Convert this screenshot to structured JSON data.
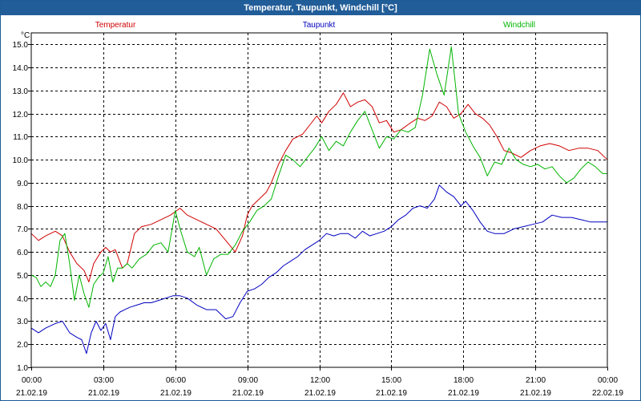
{
  "window_title": "Temperatur, Taupunkt, Windchill [°C]",
  "colors": {
    "temperatur": "#d00000",
    "taupunkt": "#0000c0",
    "windchill": "#00b400",
    "titlebar": "#215d98"
  },
  "chart_data": {
    "type": "line",
    "title": "Temperatur, Taupunkt, Windchill [°C]",
    "ylabel": "°C",
    "ylim": [
      1.0,
      15.5
    ],
    "yticks": [
      "1.0",
      "2.0",
      "3.0",
      "4.0",
      "5.0",
      "6.0",
      "7.0",
      "8.0",
      "9.0",
      "10.0",
      "11.0",
      "12.0",
      "13.0",
      "14.0",
      "15.0"
    ],
    "xlim_hours": [
      0,
      24
    ],
    "xticks": [
      {
        "time": "00:00",
        "date": "21.02.19"
      },
      {
        "time": "03:00",
        "date": "21.02.19"
      },
      {
        "time": "06:00",
        "date": "21.02.19"
      },
      {
        "time": "09:00",
        "date": "21.02.19"
      },
      {
        "time": "12:00",
        "date": "21.02.19"
      },
      {
        "time": "15:00",
        "date": "21.02.19"
      },
      {
        "time": "18:00",
        "date": "21.02.19"
      },
      {
        "time": "21:00",
        "date": "21.02.19"
      },
      {
        "time": "00:00",
        "date": "22.02.19"
      }
    ],
    "grid": true,
    "series": [
      {
        "name": "Temperatur",
        "color": "#d00000",
        "x": [
          0,
          0.3,
          0.6,
          1,
          1.3,
          1.6,
          1.9,
          2.2,
          2.4,
          2.6,
          2.9,
          3.1,
          3.3,
          3.5,
          3.8,
          4,
          4.3,
          4.6,
          5,
          5.4,
          5.8,
          6.2,
          6.5,
          6.9,
          7.3,
          7.7,
          8.1,
          8.5,
          8.8,
          9,
          9.2,
          9.5,
          9.8,
          10,
          10.3,
          10.6,
          10.9,
          11.3,
          11.6,
          11.9,
          12.1,
          12.4,
          12.7,
          13,
          13.3,
          13.6,
          13.9,
          14.2,
          14.5,
          14.8,
          15.1,
          15.4,
          15.8,
          16.1,
          16.4,
          16.7,
          17,
          17.3,
          17.6,
          17.9,
          18.2,
          18.5,
          18.8,
          19.1,
          19.4,
          19.7,
          20,
          20.4,
          20.8,
          21.2,
          21.6,
          22,
          22.4,
          22.8,
          23.2,
          23.6,
          24
        ],
        "y": [
          6.8,
          6.5,
          6.7,
          6.9,
          6.7,
          6.0,
          5.5,
          5.2,
          4.7,
          5.5,
          6.0,
          6.2,
          6.0,
          6.1,
          5.3,
          5.5,
          6.8,
          7.1,
          7.2,
          7.4,
          7.6,
          7.9,
          7.6,
          7.4,
          7.2,
          7.0,
          6.5,
          6.0,
          6.7,
          7.6,
          8.0,
          8.3,
          8.6,
          9.0,
          9.8,
          10.4,
          10.9,
          11.1,
          11.5,
          11.9,
          11.6,
          12.1,
          12.4,
          12.9,
          12.3,
          12.5,
          12.6,
          12.3,
          11.6,
          11.7,
          11.2,
          11.3,
          11.6,
          11.8,
          11.7,
          11.9,
          12.5,
          12.3,
          11.8,
          12.0,
          12.4,
          12.0,
          11.8,
          11.5,
          11.0,
          10.4,
          10.3,
          10.1,
          10.4,
          10.6,
          10.7,
          10.6,
          10.4,
          10.5,
          10.5,
          10.4,
          10.0
        ]
      },
      {
        "name": "Taupunkt",
        "color": "#0000c0",
        "x": [
          0,
          0.3,
          0.6,
          1,
          1.3,
          1.6,
          1.9,
          2.1,
          2.3,
          2.5,
          2.7,
          2.9,
          3.1,
          3.3,
          3.5,
          3.7,
          3.9,
          4.1,
          4.4,
          4.7,
          5,
          5.3,
          5.6,
          5.9,
          6.2,
          6.5,
          6.9,
          7.3,
          7.7,
          8.1,
          8.4,
          8.7,
          9,
          9.3,
          9.6,
          9.9,
          10.2,
          10.5,
          10.8,
          11.1,
          11.4,
          11.7,
          12,
          12.3,
          12.6,
          12.9,
          13.2,
          13.5,
          13.8,
          14.1,
          14.4,
          14.7,
          15,
          15.3,
          15.6,
          15.9,
          16.2,
          16.5,
          16.8,
          17,
          17.3,
          17.6,
          17.9,
          18.1,
          18.4,
          18.7,
          19,
          19.3,
          19.7,
          20.1,
          20.5,
          20.9,
          21.3,
          21.7,
          22.1,
          22.5,
          22.9,
          23.3,
          23.7,
          24
        ],
        "y": [
          2.7,
          2.5,
          2.7,
          2.9,
          3.0,
          2.5,
          2.3,
          2.2,
          1.6,
          2.5,
          3.0,
          2.6,
          2.9,
          2.2,
          3.2,
          3.4,
          3.5,
          3.6,
          3.7,
          3.8,
          3.8,
          3.9,
          4.0,
          4.1,
          4.1,
          4.0,
          3.7,
          3.5,
          3.5,
          3.1,
          3.2,
          3.8,
          4.3,
          4.4,
          4.6,
          4.9,
          5.1,
          5.4,
          5.6,
          5.8,
          6.1,
          6.3,
          6.5,
          6.8,
          6.7,
          6.8,
          6.8,
          6.6,
          6.9,
          6.7,
          6.8,
          6.9,
          7.1,
          7.4,
          7.6,
          7.9,
          8.0,
          7.9,
          8.3,
          8.9,
          8.6,
          8.4,
          8.0,
          8.2,
          7.8,
          7.3,
          6.9,
          6.8,
          6.8,
          7.0,
          7.1,
          7.2,
          7.3,
          7.6,
          7.5,
          7.5,
          7.4,
          7.3,
          7.3,
          7.3
        ]
      },
      {
        "name": "Windchill",
        "color": "#00b400",
        "x": [
          0,
          0.2,
          0.4,
          0.6,
          0.8,
          1,
          1.2,
          1.4,
          1.6,
          1.8,
          2,
          2.2,
          2.4,
          2.6,
          2.8,
          3,
          3.2,
          3.4,
          3.6,
          3.8,
          4,
          4.2,
          4.5,
          4.8,
          5.1,
          5.4,
          5.7,
          6,
          6.2,
          6.5,
          6.8,
          7,
          7.3,
          7.6,
          7.9,
          8.2,
          8.5,
          8.8,
          9.1,
          9.4,
          9.7,
          10,
          10.3,
          10.6,
          10.9,
          11.2,
          11.5,
          11.8,
          12.1,
          12.4,
          12.7,
          13,
          13.3,
          13.6,
          13.9,
          14.2,
          14.5,
          14.8,
          15.1,
          15.4,
          15.7,
          16,
          16.3,
          16.6,
          16.9,
          17.2,
          17.5,
          17.8,
          18.1,
          18.4,
          18.7,
          19,
          19.3,
          19.6,
          19.9,
          20.2,
          20.5,
          20.8,
          21.1,
          21.4,
          21.7,
          22,
          22.3,
          22.6,
          22.9,
          23.2,
          23.5,
          23.8,
          24
        ],
        "y": [
          5.0,
          4.9,
          4.5,
          4.7,
          4.5,
          5.0,
          6.5,
          6.8,
          5.5,
          3.9,
          5.0,
          4.2,
          3.6,
          4.6,
          4.9,
          5.1,
          5.8,
          4.7,
          5.3,
          5.3,
          5.5,
          5.3,
          5.7,
          5.9,
          6.3,
          6.4,
          6.0,
          7.8,
          7.0,
          6.0,
          5.8,
          6.2,
          5.0,
          5.7,
          5.9,
          5.9,
          6.3,
          6.9,
          7.3,
          7.8,
          8.0,
          8.3,
          9.3,
          10.2,
          10.0,
          9.7,
          10.1,
          10.5,
          11.0,
          10.4,
          10.8,
          10.6,
          11.2,
          11.7,
          12.1,
          11.3,
          10.5,
          11.0,
          10.9,
          11.3,
          11.2,
          11.4,
          12.8,
          14.8,
          13.7,
          12.8,
          14.9,
          12.0,
          11.2,
          10.6,
          10.1,
          9.3,
          9.9,
          9.8,
          10.5,
          10.0,
          9.8,
          9.7,
          9.8,
          9.6,
          9.7,
          9.3,
          9.0,
          9.2,
          9.6,
          9.9,
          9.7,
          9.4,
          9.4
        ]
      }
    ]
  }
}
